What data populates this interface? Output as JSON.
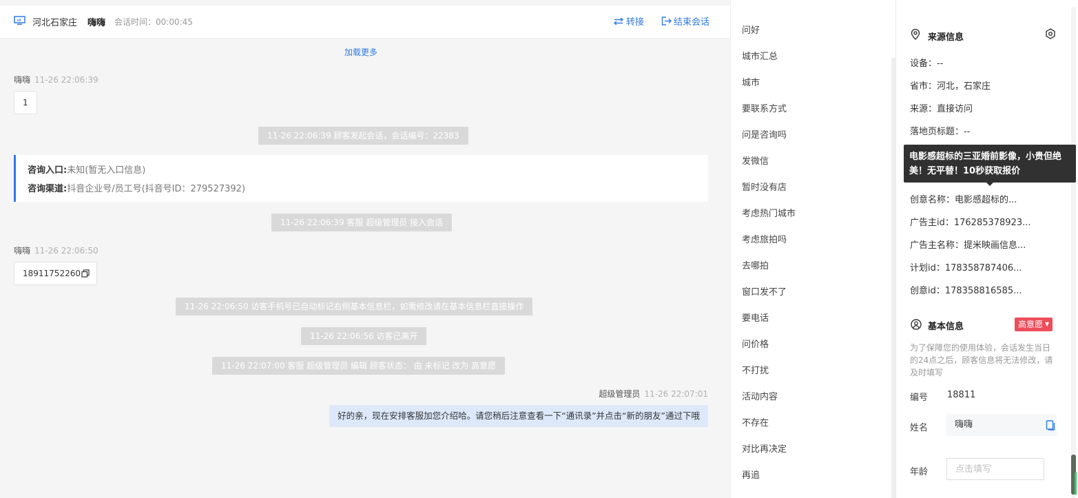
{
  "header": {
    "city": "河北石家庄",
    "name": "嗨嗨",
    "session_time": "会话时间：00:00:45",
    "transfer_label": "转接",
    "end_label": "结束会话"
  },
  "chat": {
    "load_more": "加载更多",
    "msg1": {
      "sender": "嗨嗨",
      "time": "11-26 22:06:39",
      "text": "1"
    },
    "sys1": "11-26 22:06:39 顾客发起会话，会话编号：22383",
    "consult_entry_label": "咨询入口:",
    "consult_entry_value": "未知(暂无入口信息)",
    "consult_channel_label": "咨询渠道:",
    "consult_channel_value": "抖音企业号/员工号(抖音号ID：279527392)",
    "sys2": "11-26 22:06:39 客服 超级管理员 接入会话",
    "msg2": {
      "sender": "嗨嗨",
      "time": "11-26 22:06:50",
      "text": "18911752260"
    },
    "sys3": "11-26 22:06:50 访客手机号已自动标记右侧基本信息栏，如需修改请在基本信息栏直接操作",
    "sys4": "11-26 22:06:56 访客已离开",
    "sys5": "11-26 22:07:00 客服 超级管理员 编辑 顾客状态： 由 未标记 改为 高意愿",
    "msg3": {
      "sender": "超级管理员",
      "time": "11-26 22:07:01",
      "text": "好的亲，现在安排客服加您介绍哈。请您稍后注意查看一下“通讯录”并点击“新的朋友”通过下哦"
    }
  },
  "quick_replies": [
    "问好",
    "城市汇总",
    "城市",
    "要联系方式",
    "问是咨询吗",
    "发微信",
    "暂时没有店",
    "考虑热门城市",
    "考虑旅拍吗",
    "去哪拍",
    "窗口发不了",
    "要电话",
    "问价格",
    "不打扰",
    "活动内容",
    "不存在",
    "对比再决定",
    "再追"
  ],
  "source": {
    "title": "来源信息",
    "device": "设备：--",
    "province": "省市：河北，石家庄",
    "origin": "来源：直接访问",
    "landing_title": "落地页标题：--",
    "creative_name": "创意名称：电影感超标的...",
    "advertiser_id": "广告主id：176285378923...",
    "advertiser_name": "广告主名称：提米映画信息...",
    "plan_id": "计划id：178358787406...",
    "creative_id": "创意id：178358816585..."
  },
  "tooltip": "电影感超标的三亚婚前影像，小贵但绝美！无平替！10秒获取报价",
  "basic": {
    "title": "基本信息",
    "status_badge": "高意愿",
    "note": "为了保障您的使用体验，会话发生当日的24点之后，顾客信息将无法修改，请及时填写",
    "id_label": "编号",
    "id_value": "18811",
    "name_label": "姓名",
    "name_value": "嗨嗨",
    "age_label": "年龄",
    "age_placeholder": "点击填写"
  }
}
